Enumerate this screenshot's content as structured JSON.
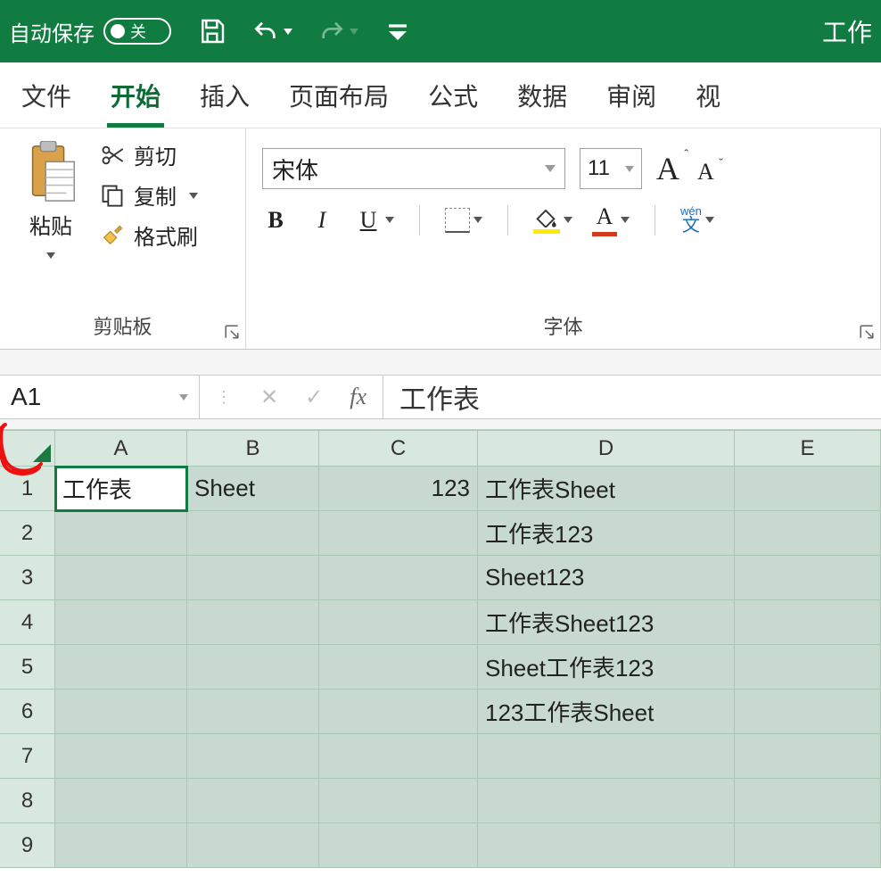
{
  "titlebar": {
    "autosave_label": "自动保存",
    "autosave_state": "关",
    "app_title_fragment": "工作"
  },
  "tabs": {
    "file": "文件",
    "home": "开始",
    "insert": "插入",
    "layout": "页面布局",
    "formulas": "公式",
    "data": "数据",
    "review": "审阅",
    "view_fragment": "视"
  },
  "ribbon": {
    "clipboard": {
      "paste": "粘贴",
      "cut": "剪切",
      "copy": "复制",
      "format_painter": "格式刷",
      "group_label": "剪贴板"
    },
    "font": {
      "font_name": "宋体",
      "font_size": "11",
      "phonetic_py": "wén",
      "phonetic_ch": "文",
      "group_label": "字体"
    }
  },
  "formula_bar": {
    "name_box": "A1",
    "fx_label": "fx",
    "value": "工作表"
  },
  "grid": {
    "columns": [
      "A",
      "B",
      "C",
      "D",
      "E"
    ],
    "rows": [
      "1",
      "2",
      "3",
      "4",
      "5",
      "6",
      "7",
      "8",
      "9"
    ],
    "cells": {
      "A1": "工作表",
      "B1": "Sheet",
      "C1": "123",
      "D1": "工作表Sheet",
      "D2": "工作表123",
      "D3": "Sheet123",
      "D4": "工作表Sheet123",
      "D5": "Sheet工作表123",
      "D6": "123工作表Sheet"
    }
  }
}
